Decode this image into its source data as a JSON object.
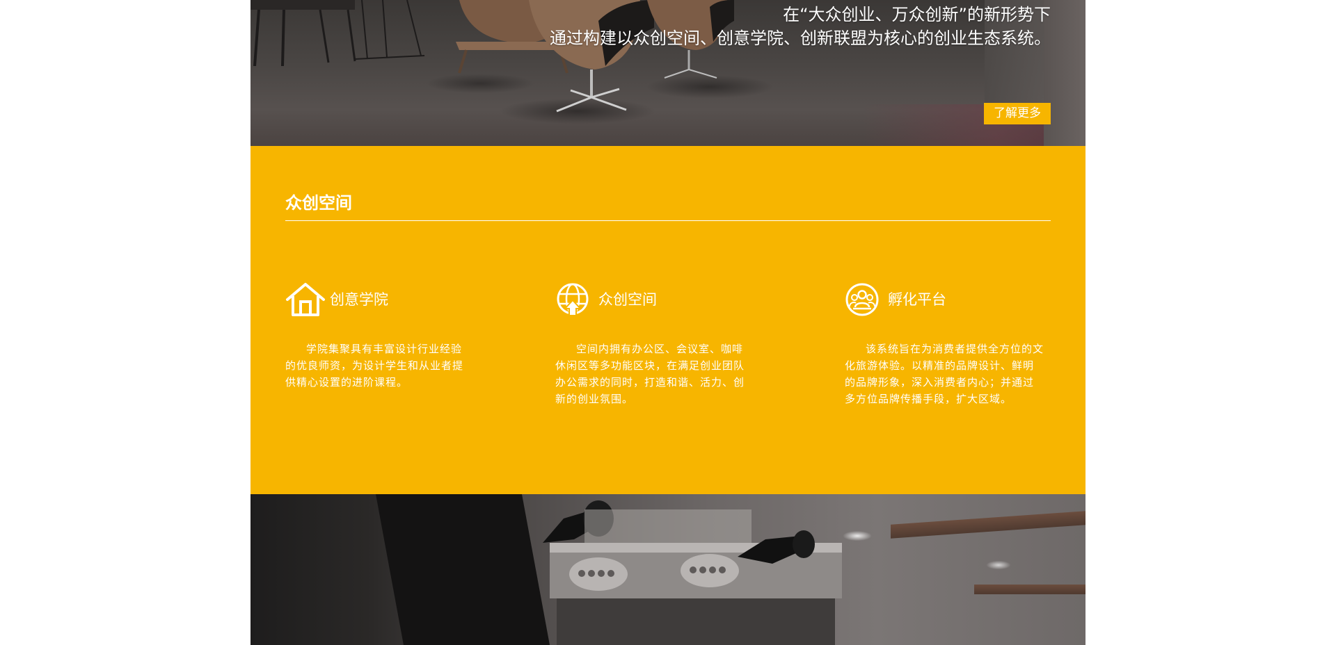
{
  "hero": {
    "line1": "在“大众创业、万众创新”的新形势下",
    "line2": "通过构建以众创空间、创意学院、创新联盟为核心的创业生态系统。",
    "more_button_label": "了解更多"
  },
  "section": {
    "title": "众创空间",
    "features": [
      {
        "icon": "house-icon",
        "title": "创意学院",
        "description": "学院集聚具有丰富设计行业经验的优良师资，为设计学生和从业者提供精心设置的进阶课程。"
      },
      {
        "icon": "globe-upload-icon",
        "title": "众创空间",
        "description": "空间内拥有办公区、会议室、咖啡休闲区等多功能区块，在满足创业团队办公需求的同时，打造和谐、活力、创新的创业氛围。"
      },
      {
        "icon": "people-group-icon",
        "title": "孵化平台",
        "description": "该系统旨在为消费者提供全方位的文化旅游体验。以精准的品牌设计、鲜明的品牌形象，深入消费者内心；并通过多方位品牌传播手段，扩大区域。"
      }
    ]
  },
  "colors": {
    "accent_yellow": "#f7b500",
    "text_white": "#ffffff"
  }
}
